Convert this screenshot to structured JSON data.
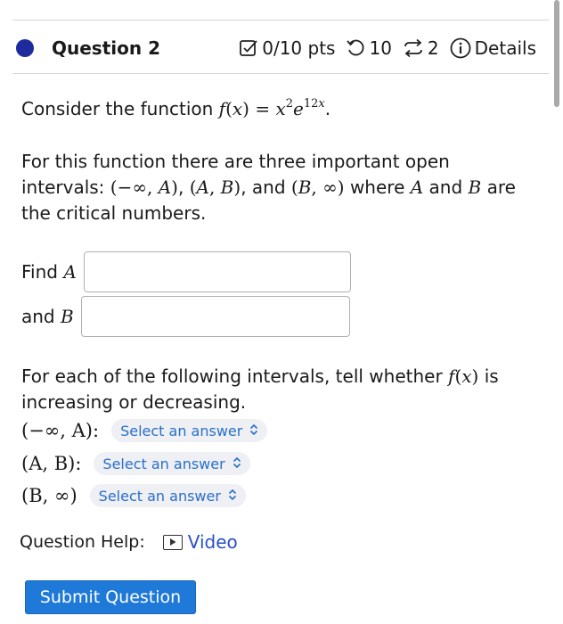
{
  "question": {
    "title": "Question 2",
    "points": "0/10 pts",
    "attempts": "10",
    "retries": "2",
    "details_label": "Details"
  },
  "problem": {
    "intro_prefix": "Consider the function ",
    "intro_suffix": ".",
    "para2_a": "For this function there are three important open intervals: ",
    "para2_b": ", ",
    "para2_c": ", and ",
    "para2_d": " where ",
    "para2_e": " and ",
    "para2_f": " are the critical numbers.",
    "find_label": "Find",
    "and_label": "and",
    "para3_a": "For each of the following intervals, tell whether ",
    "para3_b": " is increasing or decreasing."
  },
  "intervals": [
    {
      "label": "(−∞, A):",
      "select": "Select an answer"
    },
    {
      "label": "(A, B):",
      "select": "Select an answer"
    },
    {
      "label": "(B, ∞)",
      "select": "Select an answer"
    }
  ],
  "help": {
    "label": "Question Help:",
    "video_label": "Video"
  },
  "submit_label": "Submit Question",
  "colors": {
    "accent": "#1e79d8",
    "dot": "#1f2a9c",
    "link": "#2a4fc7",
    "select_text": "#2a6fc9"
  }
}
